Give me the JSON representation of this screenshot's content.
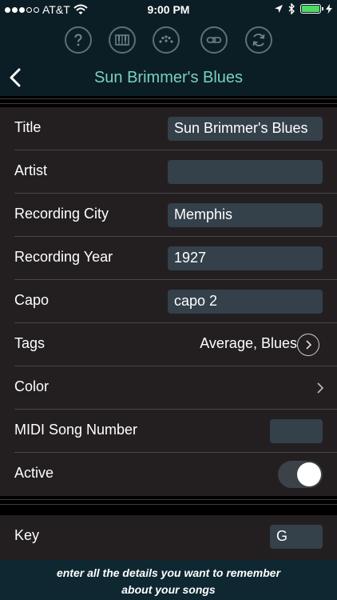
{
  "status_bar": {
    "carrier": "AT&T",
    "time": "9:00 PM",
    "signal_bars": 3
  },
  "toolbar": {
    "icons": [
      "help-icon",
      "keyboard-icon",
      "fretboard-icon",
      "link-icon",
      "sync-icon"
    ]
  },
  "nav": {
    "title": "Sun Brimmer's Blues"
  },
  "rows": [
    {
      "label": "Title",
      "value": "Sun Brimmer's Blues"
    },
    {
      "label": "Artist",
      "value": ""
    },
    {
      "label": "Recording City",
      "value": "Memphis"
    },
    {
      "label": "Recording Year",
      "value": "1927"
    },
    {
      "label": "Capo",
      "value": "capo 2"
    },
    {
      "label": "Tags",
      "value": "Average, Blues"
    },
    {
      "label": "Color"
    },
    {
      "label": "MIDI Song Number",
      "value": ""
    },
    {
      "label": "Active",
      "on": true
    }
  ],
  "key": {
    "label": "Key",
    "value": "G"
  },
  "footer": {
    "text": "enter all the details you want to remember\nabout your songs"
  },
  "colors": {
    "accent_teal": "#79d0c3",
    "toggle_track": "#3b4349",
    "field_bg": "#34404a",
    "table_bg": "#231f20",
    "header_bg": "#0c1e25"
  }
}
